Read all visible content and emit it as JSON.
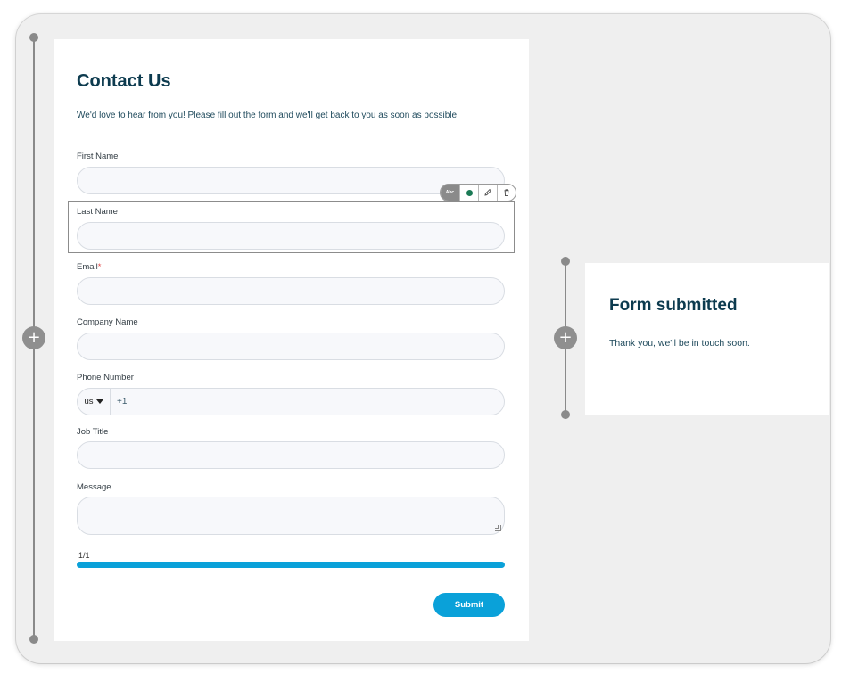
{
  "form": {
    "title": "Contact Us",
    "subtitle": "We'd love to hear from you! Please fill out the form and we'll get back to you as soon as possible.",
    "fields": {
      "first_name": {
        "label": "First Name",
        "value": ""
      },
      "last_name": {
        "label": "Last Name",
        "value": ""
      },
      "email": {
        "label": "Email",
        "required_mark": "*",
        "value": ""
      },
      "company": {
        "label": "Company Name",
        "value": ""
      },
      "phone": {
        "label": "Phone Number",
        "country": "us",
        "prefix": "+1",
        "value": ""
      },
      "job_title": {
        "label": "Job Title",
        "value": ""
      },
      "message": {
        "label": "Message",
        "value": ""
      }
    },
    "progress": {
      "label": "1/1",
      "fraction": 1.0
    },
    "submit_label": "Submit"
  },
  "field_toolbar": {
    "text_tool_label": "Abc",
    "status_color": "#1b7a55",
    "icons": [
      "text-style-icon",
      "status-dot-icon",
      "pencil-icon",
      "trash-icon"
    ]
  },
  "success": {
    "title": "Form submitted",
    "message": "Thank you, we'll be in touch soon."
  },
  "colors": {
    "accent": "#0aa1d9",
    "heading": "#0d3b4f",
    "canvas": "#efefef"
  }
}
